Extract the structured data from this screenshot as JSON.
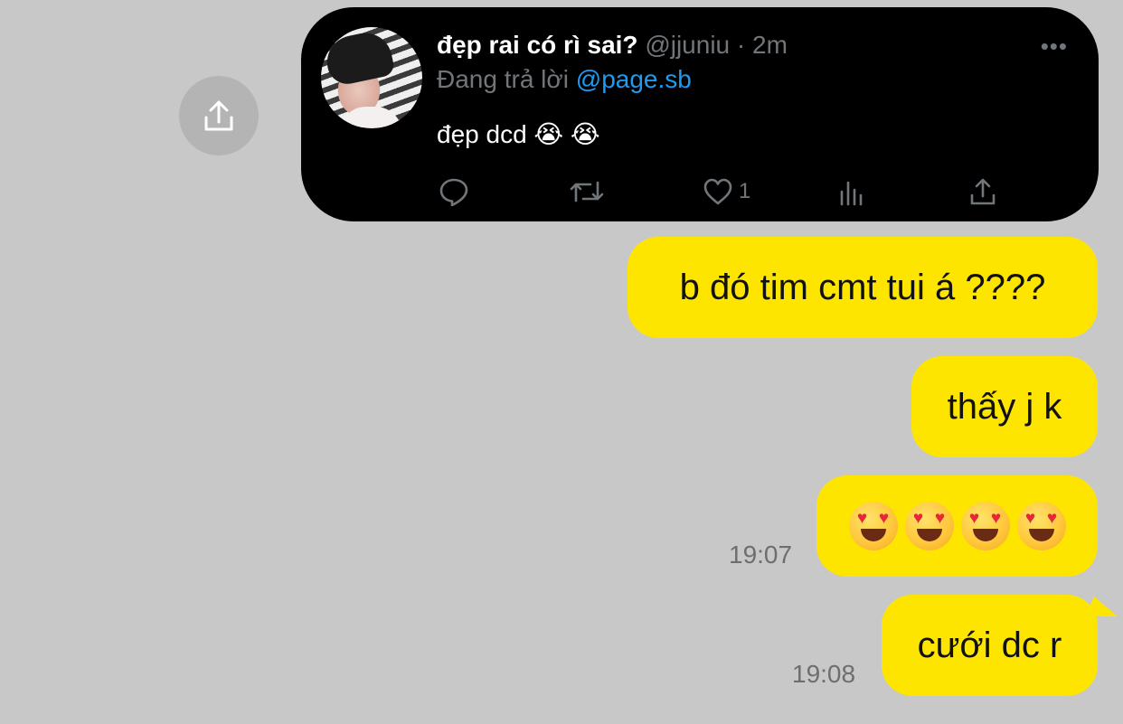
{
  "tweet": {
    "name": "đẹp rai có rì sai?",
    "handle": "@jjuniu",
    "separator": " · ",
    "time": "2m",
    "reply_prefix": "Đang trả lời ",
    "reply_to": "@page.sb",
    "text": "đẹp dcd 😭 😭",
    "more": "•••",
    "like_count": "1",
    "icons": [
      "reply-icon",
      "retweet-icon",
      "heart-icon",
      "analytics-icon",
      "share-icon"
    ]
  },
  "share_button_icon": "share-upload-icon",
  "messages": [
    {
      "text": "b đó tim cmt tui á ????",
      "time": ""
    },
    {
      "text": "thấy j k",
      "time": ""
    },
    {
      "emojis": [
        "heart-eyes-emoji",
        "heart-eyes-emoji",
        "heart-eyes-emoji",
        "heart-eyes-emoji"
      ],
      "time": "19:07"
    },
    {
      "text": "cưới dc r",
      "time": "19:08"
    }
  ],
  "colors": {
    "background": "#c8c8c8",
    "bubble": "#fee500",
    "tweet_bg": "#000000",
    "mention": "#1d9bf0",
    "muted": "#71767b"
  }
}
